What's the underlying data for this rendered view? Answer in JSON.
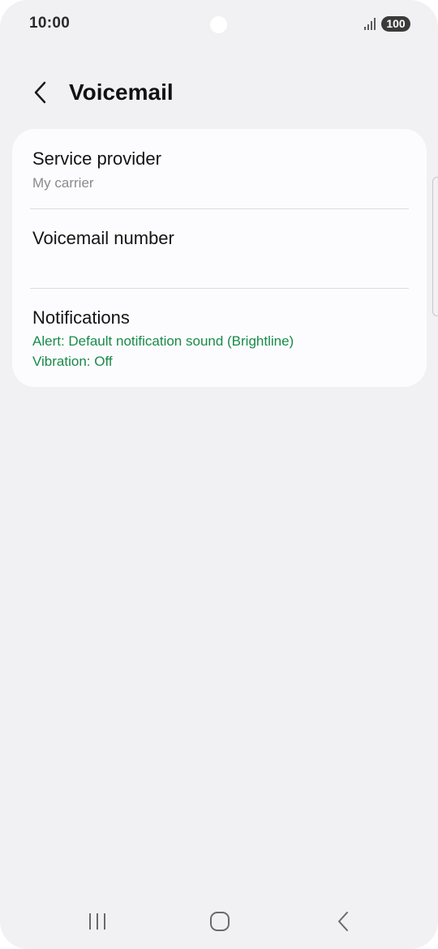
{
  "status_bar": {
    "time": "10:00",
    "battery": "100",
    "icons": [
      "signal-icon",
      "battery-icon"
    ]
  },
  "header": {
    "back_icon": "chevron-left-icon",
    "title": "Voicemail"
  },
  "settings": {
    "service_provider": {
      "title": "Service provider",
      "subtitle": "My carrier"
    },
    "voicemail_number": {
      "title": "Voicemail number"
    },
    "notifications": {
      "title": "Notifications",
      "alert": "Alert: Default notification sound (Brightline)",
      "vibration": "Vibration: Off"
    }
  },
  "nav_bar": {
    "icons": [
      "recents-icon",
      "home-icon",
      "back-icon"
    ]
  },
  "colors": {
    "background": "#f1f1f3",
    "card": "#fcfcfe",
    "accent_green": "#1a8a4a",
    "subtext_gray": "#8a8a8a"
  }
}
